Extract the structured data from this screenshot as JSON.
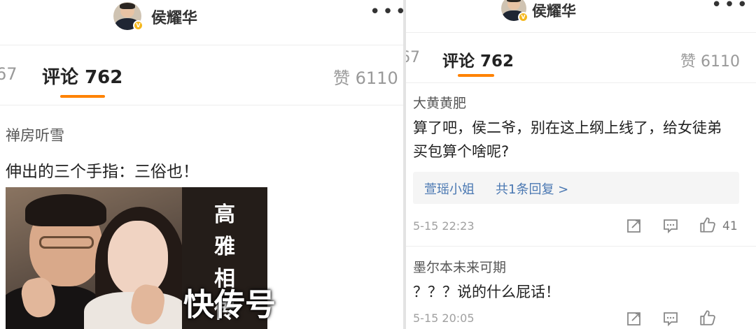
{
  "left": {
    "header": {
      "username": "侯耀华"
    },
    "tabs": {
      "prev_tab_fragment": "67",
      "comments_label": "评论",
      "comments_count": "762",
      "likes_label": "赞",
      "likes_count": "6110"
    },
    "comment": {
      "username": "禅房听雪",
      "text": "伸出的三个手指：三俗也！",
      "image_caption": [
        "高",
        "雅",
        "相",
        "传"
      ],
      "watermark": "快传号"
    }
  },
  "right": {
    "header": {
      "username": "侯耀华"
    },
    "tabs": {
      "prev_tab_fragment": "67",
      "comments_label": "评论",
      "comments_count": "762",
      "likes_label": "赞",
      "likes_count": "6110"
    },
    "comments": [
      {
        "username": "大黄黄肥",
        "text": "算了吧，侯二爷，别在这上纲上线了，给女徒弟买包算个啥呢?",
        "reply_name": "萱瑶小姐",
        "reply_count_label": "共1条回复 >",
        "timestamp": "5-15 22:23",
        "likes": "41"
      },
      {
        "username": "墨尔本未来可期",
        "text": "？？？说的什么屁话！",
        "timestamp": "5-15 20:05"
      }
    ]
  },
  "colors": {
    "accent_orange": "#ff8200",
    "link_blue": "#4a78b2",
    "badge_gold": "#f5b81e"
  }
}
